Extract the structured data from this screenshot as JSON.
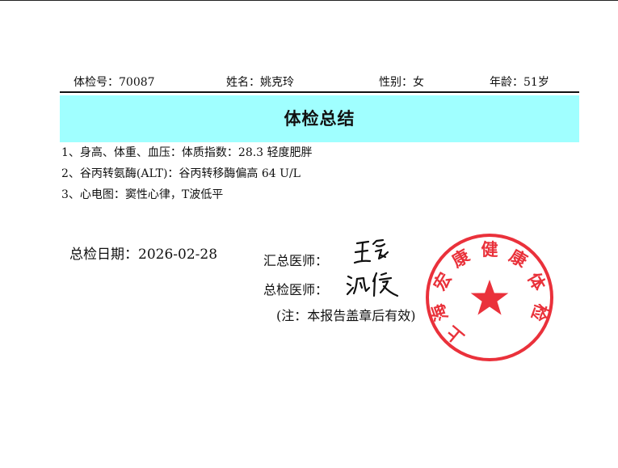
{
  "header": {
    "exam_no_label": "体检号：",
    "exam_no": "70087",
    "name_label": "姓名：",
    "name": "姚克玲",
    "gender_label": "性别：",
    "gender": "女",
    "age_label": "年龄：",
    "age": "51岁"
  },
  "title": "体检总结",
  "summary": [
    "1、身高、体重、血压：体质指数：28.3 轻度肥胖",
    "2、谷丙转氨酶(ALT)：谷丙转移酶偏高 64 U/L",
    "3、心电图：窦性心律，T波低平"
  ],
  "footer": {
    "date_label": "总检日期：",
    "date": "2026-02-28",
    "summary_doctor_label": "汇总医师：",
    "summary_doctor_signature": "王",
    "chief_doctor_label": "总检医师：",
    "chief_doctor_signature": "沈俊",
    "note": "(注：本报告盖章后有效)"
  },
  "seal": {
    "text": "上海宏康健康体检",
    "color": "#e8202a",
    "icon": "star-icon"
  }
}
